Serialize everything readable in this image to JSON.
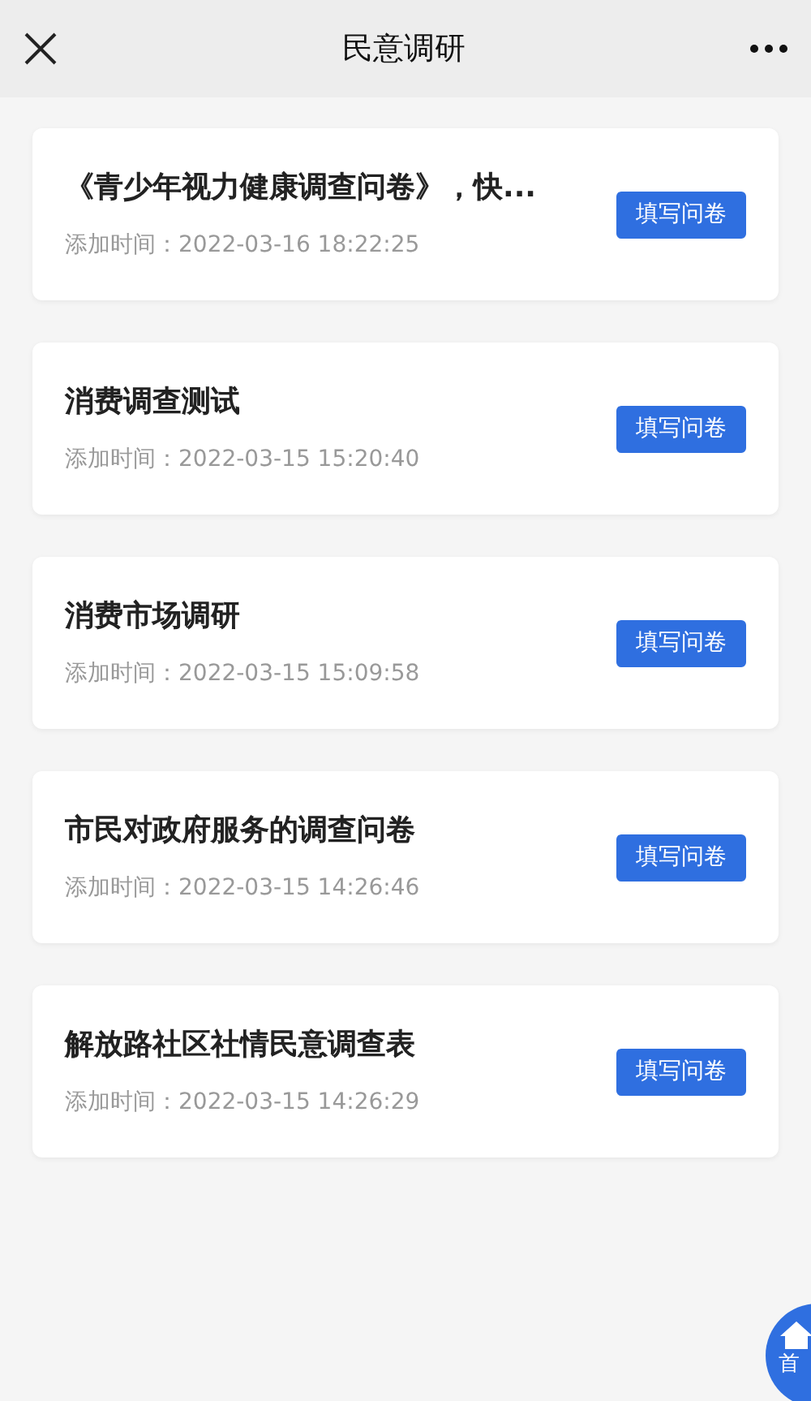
{
  "header": {
    "title": "民意调研"
  },
  "surveys": [
    {
      "title": "《青少年视力健康调查问卷》，快...",
      "added": "添加时间：2022-03-16 18:22:25",
      "action": "填写问卷"
    },
    {
      "title": "消费调查测试",
      "added": "添加时间：2022-03-15 15:20:40",
      "action": "填写问卷"
    },
    {
      "title": "消费市场调研",
      "added": "添加时间：2022-03-15 15:09:58",
      "action": "填写问卷"
    },
    {
      "title": "市民对政府服务的调查问卷",
      "added": "添加时间：2022-03-15 14:26:46",
      "action": "填写问卷"
    },
    {
      "title": "解放路社区社情民意调查表",
      "added": "添加时间：2022-03-15 14:26:29",
      "action": "填写问卷"
    }
  ],
  "home_button": {
    "label": "首"
  }
}
